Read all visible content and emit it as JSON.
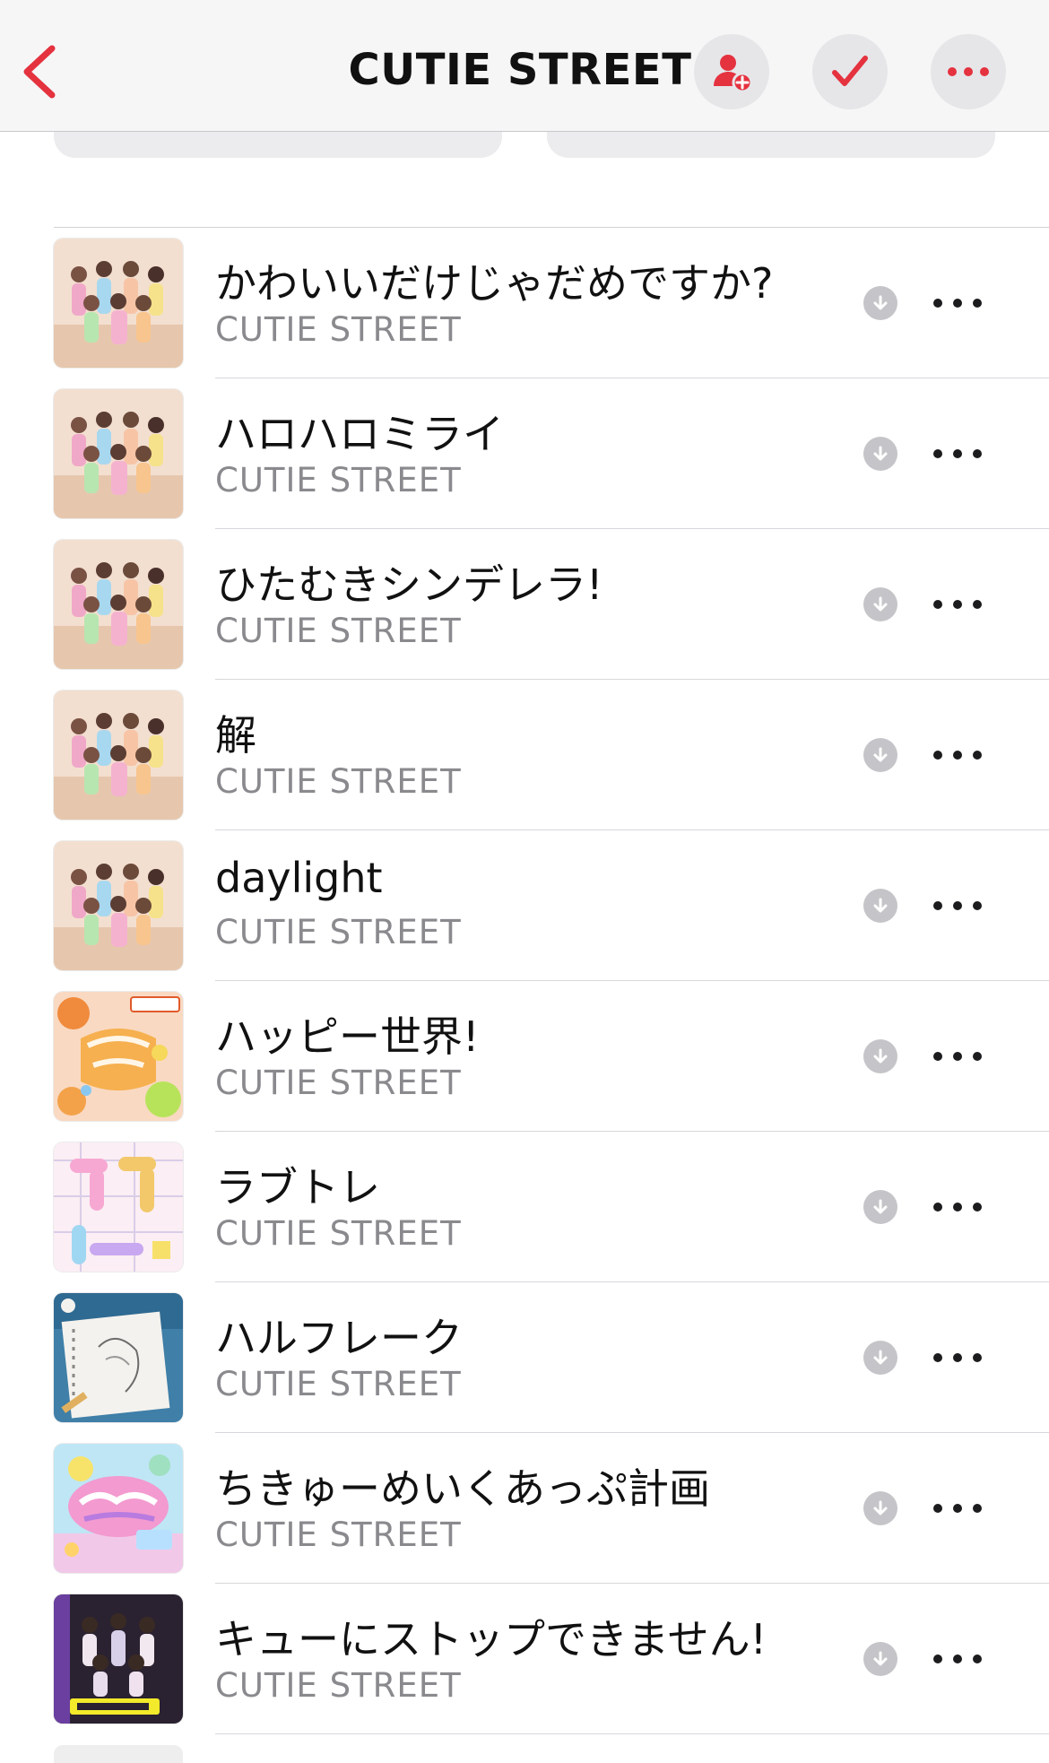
{
  "header": {
    "title": "CUTIE STREET",
    "icons": {
      "back": "chevron-left-icon",
      "add": "person-add-icon",
      "check": "checkmark-icon",
      "more": "ellipsis-icon"
    },
    "accent_color": "#e5323f"
  },
  "songs": [
    {
      "title": "かわいいだけじゃだめですか?",
      "artist": "CUTIE STREET",
      "art": "group-photo"
    },
    {
      "title": "ハロハロミライ",
      "artist": "CUTIE STREET",
      "art": "group-photo"
    },
    {
      "title": "ひたむきシンデレラ!",
      "artist": "CUTIE STREET",
      "art": "group-photo"
    },
    {
      "title": "解",
      "artist": "CUTIE STREET",
      "art": "group-photo"
    },
    {
      "title": "daylight",
      "artist": "CUTIE STREET",
      "art": "group-photo"
    },
    {
      "title": "ハッピー世界!",
      "artist": "CUTIE STREET",
      "art": "happy-orange"
    },
    {
      "title": "ラブトレ",
      "artist": "CUTIE STREET",
      "art": "lovetore-pastel"
    },
    {
      "title": "ハルフレーク",
      "artist": "CUTIE STREET",
      "art": "sketch-blue"
    },
    {
      "title": "ちきゅーめいくあっぷ計画",
      "artist": "CUTIE STREET",
      "art": "pastel-colorful"
    },
    {
      "title": "キューにストップできません!",
      "artist": "CUTIE STREET",
      "art": "group-dark"
    }
  ]
}
